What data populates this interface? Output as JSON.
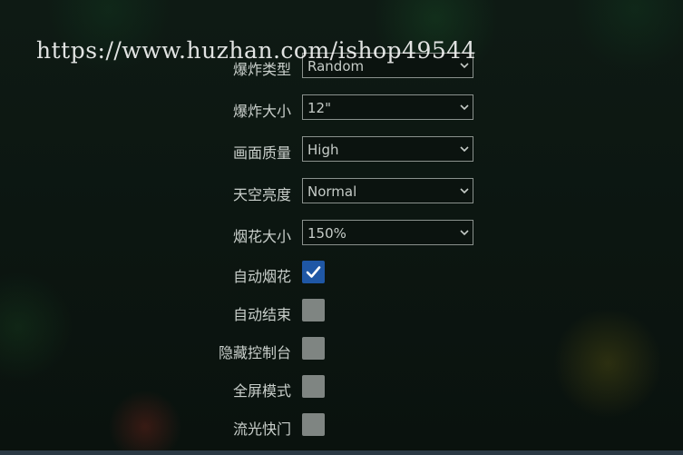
{
  "watermark": "https://www.huzhan.com/ishop49544",
  "colors": {
    "checkbox_checked": "#1f57a5",
    "checkbox_unchecked": "#7f8582",
    "text": "#c9cfcb"
  },
  "settings": {
    "burst_type": {
      "label": "爆炸类型",
      "value": "Random"
    },
    "burst_size": {
      "label": "爆炸大小",
      "value": "12\""
    },
    "quality": {
      "label": "画面质量",
      "value": "High"
    },
    "sky_brightness": {
      "label": "天空亮度",
      "value": "Normal"
    },
    "firework_size": {
      "label": "烟花大小",
      "value": "150%"
    },
    "auto_fireworks": {
      "label": "自动烟花",
      "checked": true
    },
    "auto_end": {
      "label": "自动结束",
      "checked": false
    },
    "hide_controls": {
      "label": "隐藏控制台",
      "checked": false
    },
    "fullscreen": {
      "label": "全屏模式",
      "checked": false
    },
    "shutter": {
      "label": "流光快门",
      "checked": false
    }
  }
}
